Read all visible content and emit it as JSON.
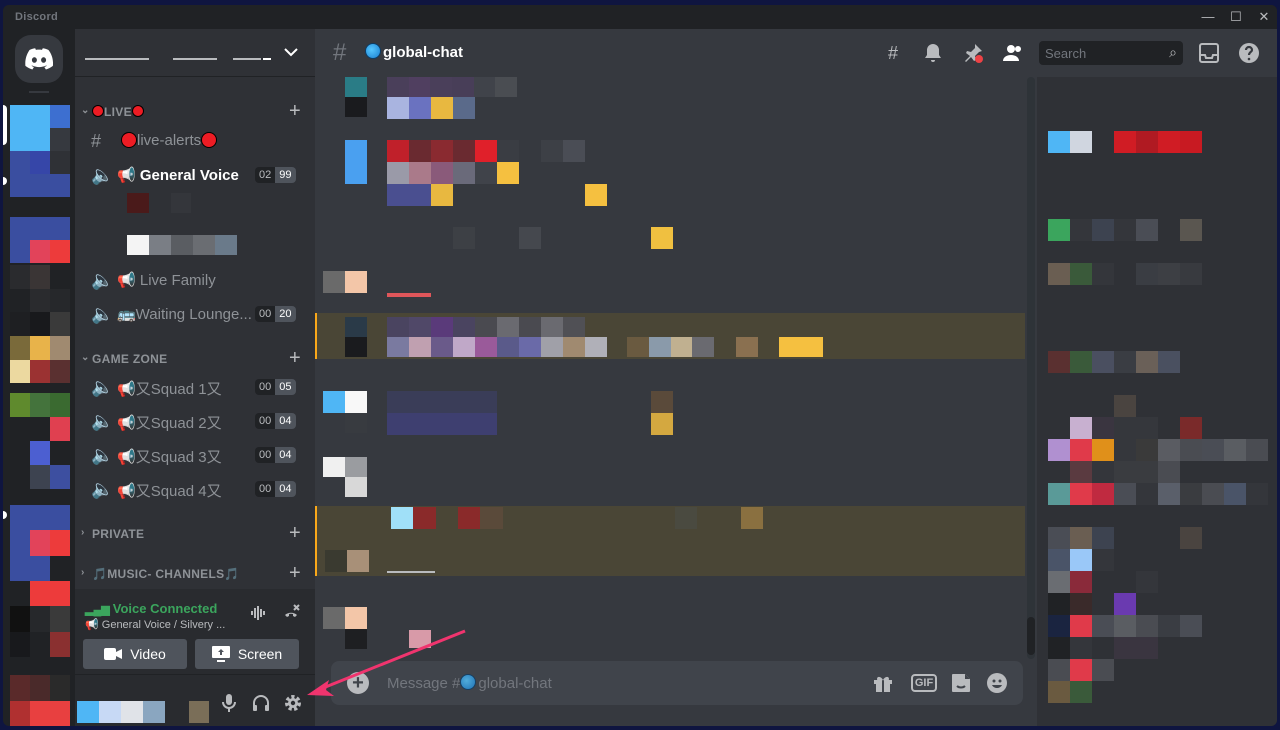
{
  "app": {
    "name": "Discord"
  },
  "window_controls": {
    "minimize": "—",
    "maximize": "☐",
    "close": "✕"
  },
  "sidebar": {
    "categories": [
      {
        "name": "LIVE",
        "decorated": true
      },
      {
        "name": "GAME ZONE"
      },
      {
        "name": "PRIVATE"
      },
      {
        "name": "🎵MUSIC- CHANNELS🎵"
      }
    ],
    "channels": [
      {
        "label": "live-alerts",
        "icon": "hash-icon"
      },
      {
        "label": "General Voice",
        "icon": "speaker-icon",
        "count_a": "02",
        "count_b": "99"
      },
      {
        "label": "Live Family",
        "icon": "speaker-icon"
      },
      {
        "label": "🚌Waiting Lounge...",
        "icon": "speaker-icon",
        "count_a": "00",
        "count_b": "20"
      },
      {
        "label": "又Squad 1又",
        "icon": "speaker-icon",
        "count_a": "00",
        "count_b": "05"
      },
      {
        "label": "又Squad 2又",
        "icon": "speaker-icon",
        "count_a": "00",
        "count_b": "04"
      },
      {
        "label": "又Squad 3又",
        "icon": "speaker-icon",
        "count_a": "00",
        "count_b": "04"
      },
      {
        "label": "又Squad 4又",
        "icon": "speaker-icon",
        "count_a": "00",
        "count_b": "04"
      }
    ],
    "add_symbol": "+",
    "voice": {
      "status": "Voice Connected",
      "sub": "General Voice / Silvery ...",
      "video_label": "Video",
      "screen_label": "Screen"
    }
  },
  "chat": {
    "channel_name": "global-chat",
    "composer_placeholder": "Message #",
    "composer_channel": "global-chat",
    "gif_label": "GIF"
  },
  "toolbar": {
    "search_placeholder": "Search"
  },
  "colors": {
    "accent": "#5865f2",
    "green": "#3ba55d",
    "highlight": "#faa81a",
    "arrow": "#f0346e"
  }
}
